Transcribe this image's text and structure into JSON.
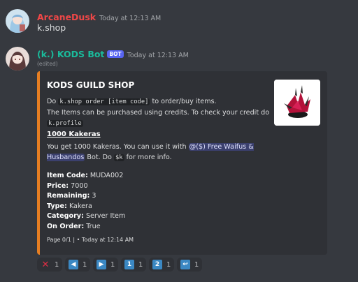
{
  "messages": [
    {
      "username": "ArcaneDusk",
      "username_color": "#f04747",
      "timestamp": "Today at 12:13 AM",
      "content": "k.shop"
    },
    {
      "username": "(k.) KODS Bot",
      "username_color": "#1abc9c",
      "badge": "BOT",
      "timestamp": "Today at 12:13 AM",
      "edited": "(edited)"
    }
  ],
  "embed": {
    "accent_color": "#e67e22",
    "title": "KODS GUILD SHOP",
    "desc_do": "Do ",
    "desc_cmd": "k.shop order [item code]",
    "desc_after_cmd": " to order/buy items.",
    "desc_line2": "The Items can be purchased using credits. To check your credit do",
    "desc_cmd2": "k.profile",
    "subtitle": "1000 Kakeras",
    "sub_text1": "You get 1000 Kakeras. You can use it with ",
    "sub_mention": "@($) Free Waifus & Husbandos",
    "sub_text2": " Bot. Do ",
    "sub_cmd": "$k",
    "sub_text3": " for more info.",
    "fields": [
      {
        "name": "Item Code:",
        "value": "MUDA002"
      },
      {
        "name": "Price:",
        "value": "7000"
      },
      {
        "name": "Remaining:",
        "value": "3"
      },
      {
        "name": "Type:",
        "value": "Kakera"
      },
      {
        "name": "Category:",
        "value": "Server Item"
      },
      {
        "name": "On Order:",
        "value": "True"
      }
    ],
    "footer": "Page 0/1 | • Today at 12:14 AM"
  },
  "reactions": [
    {
      "icon": "cross-mark-icon",
      "symbol": "✕",
      "color": "#dd2e44",
      "count": "1"
    },
    {
      "icon": "left-arrow-icon",
      "symbol": "◀",
      "color": "#3b88c3",
      "count": "1"
    },
    {
      "icon": "right-arrow-icon",
      "symbol": "▶",
      "color": "#3b88c3",
      "count": "1"
    },
    {
      "icon": "keycap-1-icon",
      "symbol": "1",
      "color": "#3b88c3",
      "count": "1"
    },
    {
      "icon": "keycap-2-icon",
      "symbol": "2",
      "color": "#3b88c3",
      "count": "1"
    },
    {
      "icon": "return-arrow-icon",
      "symbol": "↩",
      "color": "#3b88c3",
      "count": "1"
    }
  ]
}
